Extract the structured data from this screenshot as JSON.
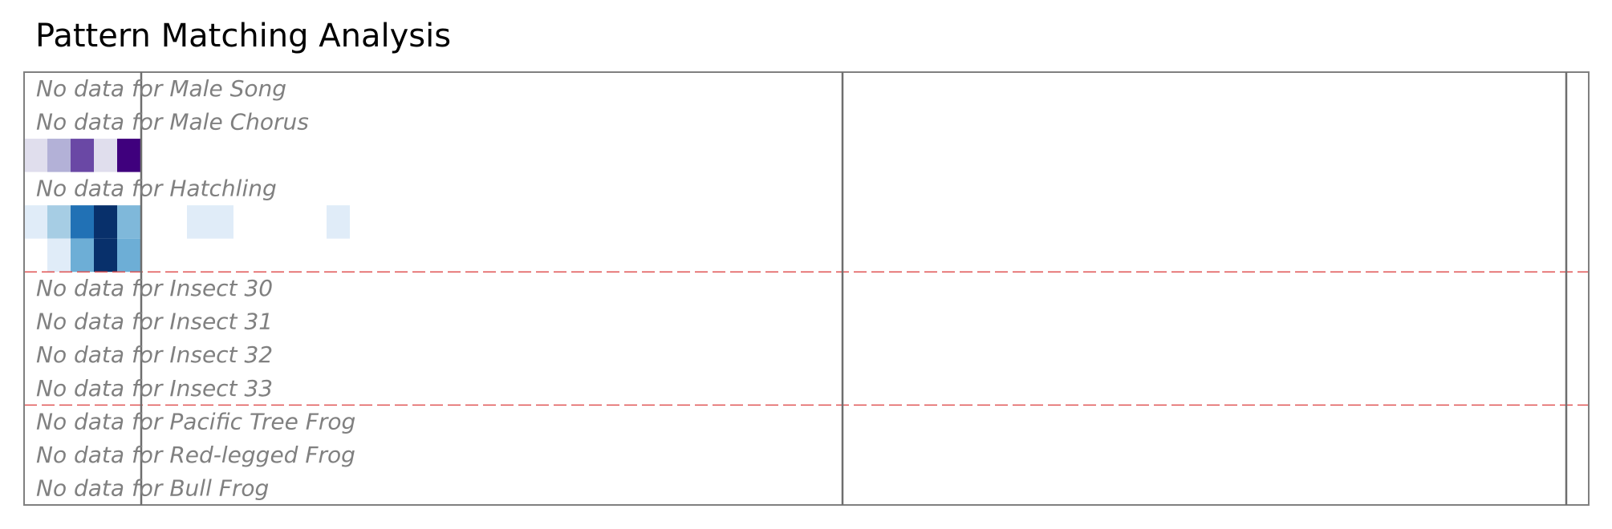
{
  "page": {
    "title": "Pattern Matching Analysis"
  },
  "chart_data": {
    "type": "heatmap",
    "title": "Pattern Matching Analysis",
    "colormaps": {
      "purple": [
        "#e0deed",
        "#b3b1d7",
        "#6a48a5",
        "#3f007d"
      ],
      "blue": [
        "#e0ecf8",
        "#a6cde4",
        "#6daed6",
        "#2171b5",
        "#08306b",
        "#7fb8da"
      ]
    },
    "rows": [
      {
        "name": "Male Song",
        "has_data": false,
        "message": "No data for Male Song"
      },
      {
        "name": "Male Chorus",
        "has_data": false,
        "message": "No data for Male Chorus"
      },
      {
        "name": "",
        "has_data": true,
        "cells": [
          {
            "col": 0,
            "color": "#e0deed"
          },
          {
            "col": 1,
            "color": "#b3b1d7"
          },
          {
            "col": 2,
            "color": "#6a48a5"
          },
          {
            "col": 3,
            "color": "#e0deed"
          },
          {
            "col": 4,
            "color": "#3f007d"
          }
        ]
      },
      {
        "name": "Hatchling",
        "has_data": false,
        "message": "No data for Hatchling"
      },
      {
        "name": "",
        "has_data": true,
        "cells": [
          {
            "col": 0,
            "color": "#e0ecf8"
          },
          {
            "col": 1,
            "color": "#a6cde4"
          },
          {
            "col": 2,
            "color": "#2171b5"
          },
          {
            "col": 3,
            "color": "#08306b"
          },
          {
            "col": 4,
            "color": "#7fb8da"
          },
          {
            "col": 7,
            "color": "#e0ecf8"
          },
          {
            "col": 8,
            "color": "#e0ecf8"
          },
          {
            "col": 13,
            "color": "#e0ecf8"
          }
        ]
      },
      {
        "name": "",
        "has_data": true,
        "cells": [
          {
            "col": 1,
            "color": "#e0ecf8"
          },
          {
            "col": 2,
            "color": "#6daed6"
          },
          {
            "col": 3,
            "color": "#08306b"
          },
          {
            "col": 4,
            "color": "#6daed6"
          }
        ]
      },
      {
        "name": "Insect 30",
        "has_data": false,
        "message": "No data for Insect 30"
      },
      {
        "name": "Insect 31",
        "has_data": false,
        "message": "No data for Insect 31"
      },
      {
        "name": "Insect 32",
        "has_data": false,
        "message": "No data for Insect 32"
      },
      {
        "name": "Insect 33",
        "has_data": false,
        "message": "No data for Insect 33"
      },
      {
        "name": "Pacific Tree Frog",
        "has_data": false,
        "message": "No data for Pacific Tree Frog"
      },
      {
        "name": "Red-legged Frog",
        "has_data": false,
        "message": "No data for Red-legged Frog"
      },
      {
        "name": "Bull Frog",
        "has_data": false,
        "message": "No data for Bull Frog"
      }
    ],
    "group_separators_after_row": [
      5,
      9
    ],
    "separator_color": "#e05555",
    "vertical_markers": true,
    "grid": false,
    "legend": "none"
  }
}
